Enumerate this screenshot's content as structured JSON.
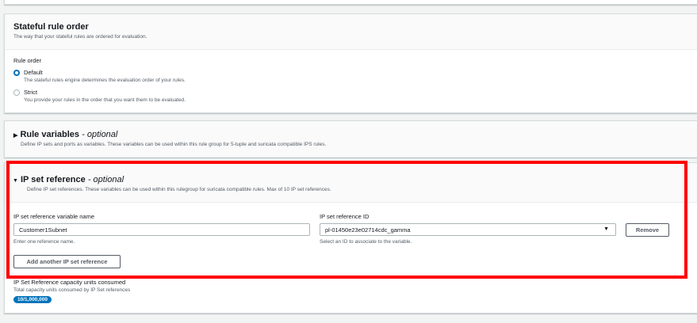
{
  "stateful": {
    "title": "Stateful rule order",
    "description": "The way that your stateful rules are ordered for evaluation.",
    "rule_order_label": "Rule order",
    "options": [
      {
        "label": "Default",
        "description": "The stateful rules engine determines the evaluation order of your rules.",
        "selected": true
      },
      {
        "label": "Strict",
        "description": "You provide your rules in the order that you want them to be evaluated.",
        "selected": false
      }
    ]
  },
  "rule_variables": {
    "title": "Rule variables",
    "optional": "- optional",
    "description": "Define IP sets and ports as variables. These variables can be used within this rule group for 5-tuple and suricata compatible IPS rules."
  },
  "ip_set": {
    "title": "IP set reference",
    "optional": "- optional",
    "description": "Define IP set references. These variables can be used within this rulegroup for suricata compatible rules. Max of 10 IP set references.",
    "name_label": "IP set reference variable name",
    "name_value": "Customer1Subnet",
    "name_hint": "Enter one reference name.",
    "id_label": "IP set reference ID",
    "id_value": "pl-01450e23e02714cdc_gamma",
    "id_hint": "Select an ID to associate to the variable.",
    "remove_label": "Remove",
    "add_label": "Add another IP set reference",
    "capacity_label": "IP Set Reference capacity units consumed",
    "capacity_desc": "Total capacity units consumed by IP Set references",
    "capacity_value": "10/1,000,000"
  },
  "colors": {
    "highlight": "#ff0000",
    "accent": "#0073bb"
  }
}
